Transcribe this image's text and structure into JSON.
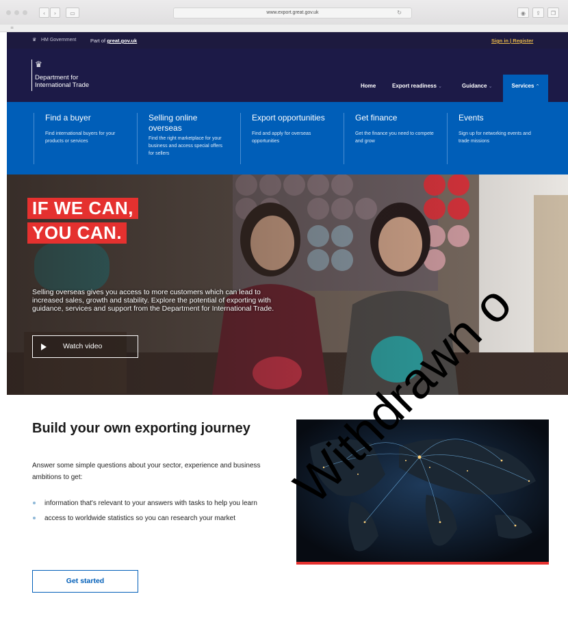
{
  "browser": {
    "url": "www.export.great.gov.uk",
    "reload_icon": "reload-icon",
    "traffic_lights": [
      "close",
      "minimize",
      "zoom"
    ]
  },
  "govbar": {
    "crest_icon": "royal-crest-icon",
    "org": "HM Government",
    "part_of_prefix": "Part of",
    "part_of_link": "great.gov.uk",
    "sign_in": "Sign in",
    "separator": "|",
    "register": "Register"
  },
  "header": {
    "dept_line1": "Department for",
    "dept_line2": "International Trade",
    "nav": [
      {
        "label": "Home",
        "chevron": ""
      },
      {
        "label": "Export readiness",
        "chevron": "⌄"
      },
      {
        "label": "Guidance",
        "chevron": "⌄"
      },
      {
        "label": "Services",
        "chevron": "⌃"
      }
    ]
  },
  "services_menu": [
    {
      "title": "Find a buyer",
      "desc": "Find international buyers for your products or services"
    },
    {
      "title": "Selling online overseas",
      "desc": "Find the right marketplace for your business and access special offers for sellers"
    },
    {
      "title": "Export opportunities",
      "desc": "Find and apply for overseas opportunities"
    },
    {
      "title": "Get finance",
      "desc": "Get the finance you need to compete and grow"
    },
    {
      "title": "Events",
      "desc": "Sign up for networking events and trade missions"
    }
  ],
  "hero": {
    "headline_line1": "IF WE CAN,",
    "headline_line2": "YOU CAN.",
    "body": "Selling overseas gives you access to more customers which can lead to increased sales, growth and stability. Explore the potential of exporting with guidance, services and support from the Department for International Trade.",
    "watch_video": "Watch video"
  },
  "journey": {
    "title": "Build your own exporting journey",
    "intro": "Answer some simple questions about your sector, experience and business ambitions to get:",
    "bullets": [
      "information that's relevant to your answers with tasks to help you learn",
      "access to worldwide statistics so you can research your market"
    ],
    "cta": "Get started"
  },
  "watermark": "Withdrawn o",
  "colors": {
    "gov_bar": "#1d1a3f",
    "header": "#1c1a47",
    "services_blue": "#005eb8",
    "accent_red": "#e5312f",
    "link_gold": "#e8b84a"
  }
}
